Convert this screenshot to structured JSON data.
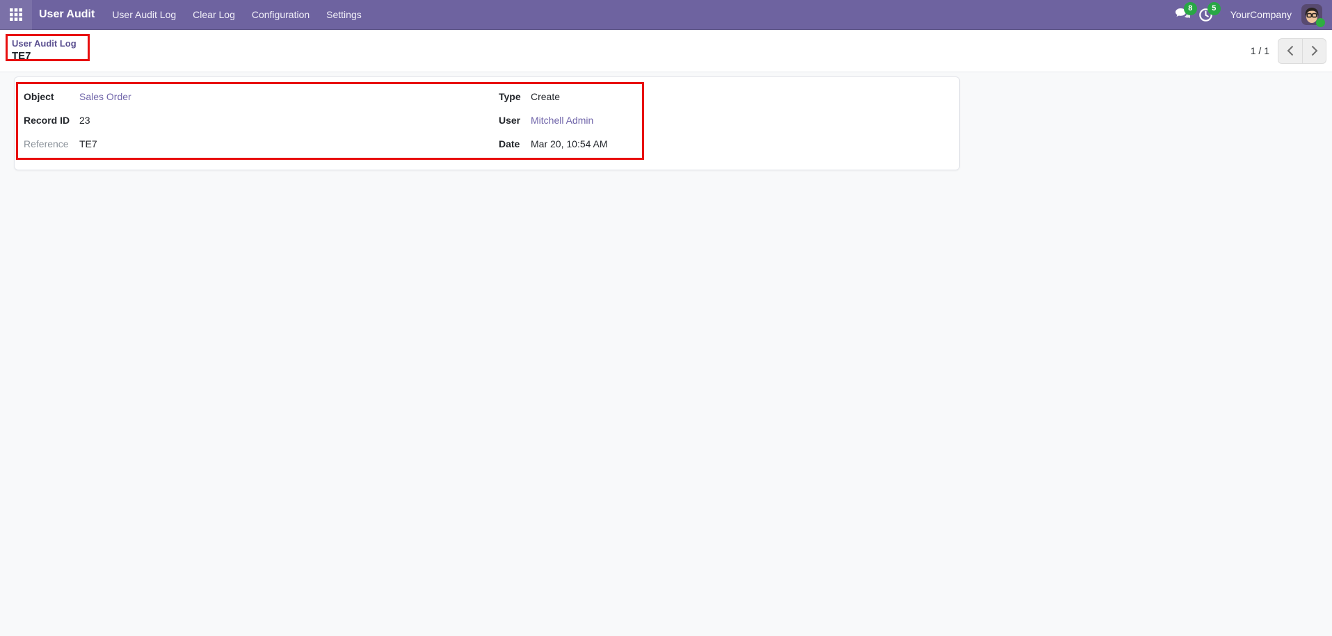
{
  "navbar": {
    "brand": "User Audit",
    "menu": [
      "User Audit Log",
      "Clear Log",
      "Configuration",
      "Settings"
    ],
    "systray": {
      "messages_badge": "8",
      "activities_badge": "5",
      "company": "YourCompany"
    }
  },
  "breadcrumb": {
    "parent": "User Audit Log",
    "record": "TE7"
  },
  "pager": {
    "counter": "1 / 1"
  },
  "form": {
    "rows": [
      {
        "label": "Object",
        "value": "Sales Order"
      },
      {
        "label": "Record ID",
        "value": "23"
      },
      {
        "label": "Reference",
        "value": "TE7"
      },
      {
        "label": "Type",
        "value": "Create"
      },
      {
        "label": "User",
        "value": "Mitchell Admin"
      },
      {
        "label": "Date",
        "value": "Mar 20, 10:54 AM"
      }
    ]
  },
  "colors": {
    "navbar": "#6e63a0",
    "link": "#6f64a9",
    "badge_green": "#28a745",
    "annotation_red": "#e80f0f"
  }
}
